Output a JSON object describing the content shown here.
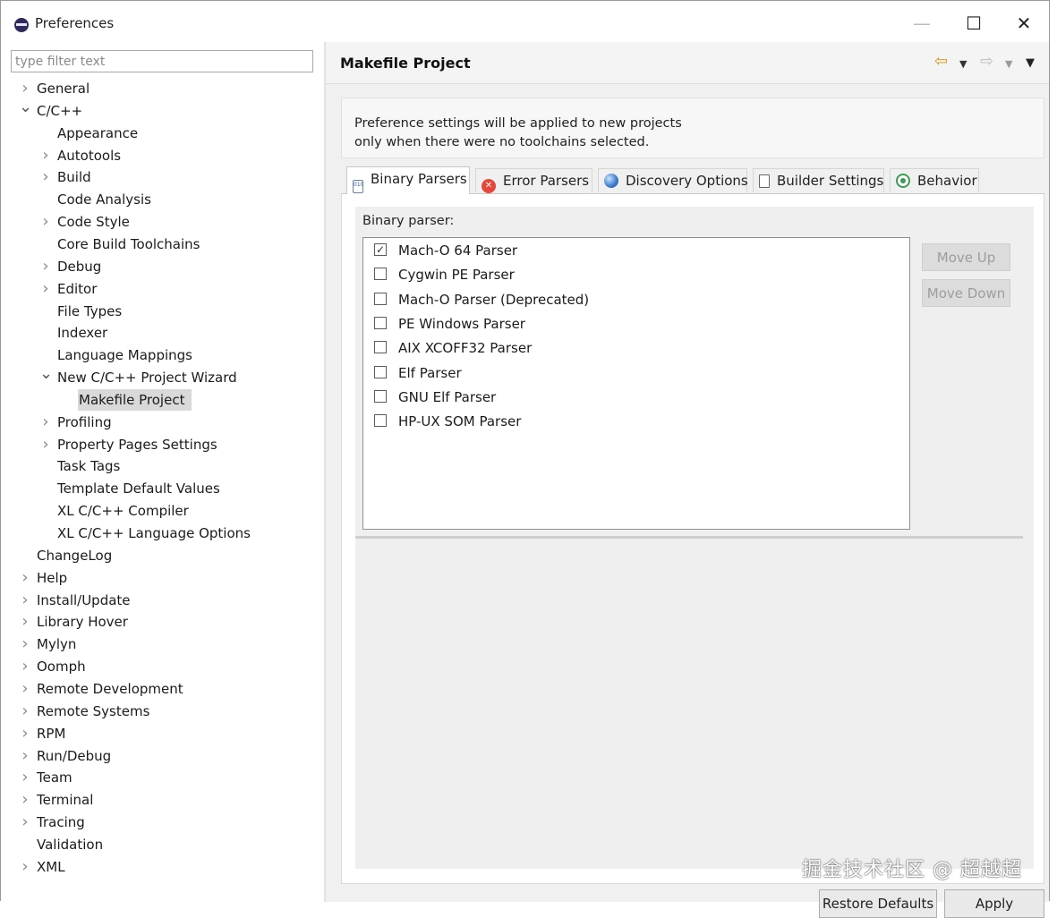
{
  "window": {
    "title": "Preferences",
    "min": "—",
    "max": "☐",
    "close": "✕"
  },
  "filter": {
    "placeholder": "type filter text"
  },
  "tree": [
    {
      "label": "General",
      "level": 0,
      "tw": "collapsed"
    },
    {
      "label": "C/C++",
      "level": 0,
      "tw": "expanded"
    },
    {
      "label": "Appearance",
      "level": 1,
      "tw": "none"
    },
    {
      "label": "Autotools",
      "level": 1,
      "tw": "collapsed"
    },
    {
      "label": "Build",
      "level": 1,
      "tw": "collapsed"
    },
    {
      "label": "Code Analysis",
      "level": 1,
      "tw": "none"
    },
    {
      "label": "Code Style",
      "level": 1,
      "tw": "collapsed"
    },
    {
      "label": "Core Build Toolchains",
      "level": 1,
      "tw": "none"
    },
    {
      "label": "Debug",
      "level": 1,
      "tw": "collapsed"
    },
    {
      "label": "Editor",
      "level": 1,
      "tw": "collapsed"
    },
    {
      "label": "File Types",
      "level": 1,
      "tw": "none"
    },
    {
      "label": "Indexer",
      "level": 1,
      "tw": "none"
    },
    {
      "label": "Language Mappings",
      "level": 1,
      "tw": "none"
    },
    {
      "label": "New C/C++ Project Wizard",
      "level": 1,
      "tw": "expanded"
    },
    {
      "label": "Makefile Project",
      "level": 2,
      "tw": "none",
      "selected": true
    },
    {
      "label": "Profiling",
      "level": 1,
      "tw": "collapsed"
    },
    {
      "label": "Property Pages Settings",
      "level": 1,
      "tw": "collapsed"
    },
    {
      "label": "Task Tags",
      "level": 1,
      "tw": "none"
    },
    {
      "label": "Template Default Values",
      "level": 1,
      "tw": "none"
    },
    {
      "label": "XL C/C++ Compiler",
      "level": 1,
      "tw": "none"
    },
    {
      "label": "XL C/C++ Language Options",
      "level": 1,
      "tw": "none"
    },
    {
      "label": "ChangeLog",
      "level": 0,
      "tw": "none"
    },
    {
      "label": "Help",
      "level": 0,
      "tw": "collapsed"
    },
    {
      "label": "Install/Update",
      "level": 0,
      "tw": "collapsed"
    },
    {
      "label": "Library Hover",
      "level": 0,
      "tw": "collapsed"
    },
    {
      "label": "Mylyn",
      "level": 0,
      "tw": "collapsed"
    },
    {
      "label": "Oomph",
      "level": 0,
      "tw": "collapsed"
    },
    {
      "label": "Remote Development",
      "level": 0,
      "tw": "collapsed"
    },
    {
      "label": "Remote Systems",
      "level": 0,
      "tw": "collapsed"
    },
    {
      "label": "RPM",
      "level": 0,
      "tw": "collapsed"
    },
    {
      "label": "Run/Debug",
      "level": 0,
      "tw": "collapsed"
    },
    {
      "label": "Team",
      "level": 0,
      "tw": "collapsed"
    },
    {
      "label": "Terminal",
      "level": 0,
      "tw": "collapsed"
    },
    {
      "label": "Tracing",
      "level": 0,
      "tw": "collapsed"
    },
    {
      "label": "Validation",
      "level": 0,
      "tw": "none"
    },
    {
      "label": "XML",
      "level": 0,
      "tw": "collapsed"
    }
  ],
  "page": {
    "title": "Makefile Project",
    "info_line1": "Preference settings will be applied to new projects",
    "info_line2": "only when there were no toolchains selected."
  },
  "tabs": [
    {
      "label": "Binary Parsers",
      "icon": "binary-file-icon",
      "active": true
    },
    {
      "label": "Error Parsers",
      "icon": "error-icon"
    },
    {
      "label": "Discovery Options",
      "icon": "globe-icon"
    },
    {
      "label": "Builder Settings",
      "icon": "document-icon"
    },
    {
      "label": "Behavior",
      "icon": "radio-icon"
    }
  ],
  "binary": {
    "label": "Binary parser:",
    "parsers": [
      {
        "label": "Mach-O 64 Parser",
        "checked": true
      },
      {
        "label": "Cygwin PE Parser",
        "checked": false
      },
      {
        "label": "Mach-O Parser (Deprecated)",
        "checked": false
      },
      {
        "label": "PE Windows Parser",
        "checked": false
      },
      {
        "label": "AIX XCOFF32 Parser",
        "checked": false
      },
      {
        "label": "Elf Parser",
        "checked": false
      },
      {
        "label": "GNU Elf Parser",
        "checked": false
      },
      {
        "label": "HP-UX SOM Parser",
        "checked": false
      }
    ],
    "move_up": "Move Up",
    "move_down": "Move Down"
  },
  "footer": {
    "restore_defaults": "Restore Defaults",
    "apply": "Apply"
  },
  "watermark": "掘金技术社区 @ 超越超",
  "colors": {
    "selection": "#d9d9d9",
    "back_arrow": "#d99a1b",
    "error": "#e5473b",
    "behavior": "#3b9c54"
  }
}
